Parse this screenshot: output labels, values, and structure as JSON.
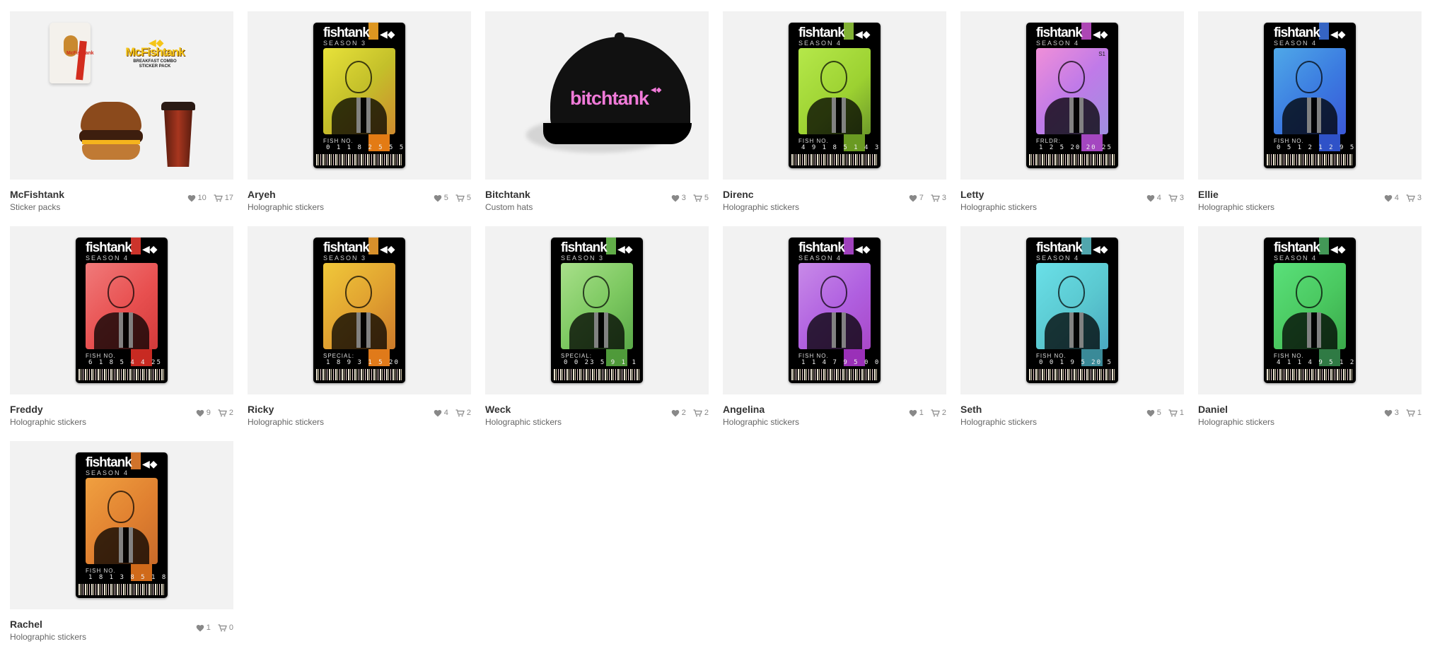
{
  "products": [
    {
      "name": "McFishtank",
      "category": "Sticker packs",
      "likes": "10",
      "carts": "17",
      "kind": "mcfishtank"
    },
    {
      "name": "Aryeh",
      "category": "Holographic stickers",
      "likes": "5",
      "carts": "5",
      "kind": "sticker",
      "season": "SEASON 3",
      "label": "FISH NO.",
      "digits": "0 1 1 8 2 5 5 5",
      "photo": "linear-gradient(135deg,#e8e23a,#c4c02a 50%,#ce8a2e)",
      "band": "#f5a623",
      "block": "#e37b14"
    },
    {
      "name": "Bitchtank",
      "category": "Custom hats",
      "likes": "3",
      "carts": "5",
      "kind": "hat",
      "hat_text": "bitchtank"
    },
    {
      "name": "Direnc",
      "category": "Holographic stickers",
      "likes": "7",
      "carts": "3",
      "kind": "sticker",
      "season": "SEASON 4",
      "label": "FISH NO.",
      "digits": "4 9 1 8 5 1 4 3",
      "photo": "linear-gradient(135deg,#b5e84a,#9cd131 60%,#6e9a2a)",
      "band": "#8fc43a",
      "block": "#6a9a22"
    },
    {
      "name": "Letty",
      "category": "Holographic stickers",
      "likes": "4",
      "carts": "3",
      "kind": "sticker",
      "season": "SEASON 4",
      "label": "FRLDR:",
      "digits": "1 2 5 20 20 25",
      "photo": "linear-gradient(135deg,#f08fd8,#c07ae8 50%,#9f8fe0)",
      "band": "#c04fc8",
      "block": "#a447c0",
      "extra": "S1"
    },
    {
      "name": "Ellie",
      "category": "Holographic stickers",
      "likes": "4",
      "carts": "3",
      "kind": "sticker",
      "season": "SEASON 4",
      "label": "FISH NO.",
      "digits": "0 5 1 2 1 2 9 5",
      "photo": "linear-gradient(135deg,#4fa8e8,#3b7ae0 55%,#3b58d8)",
      "band": "#3b6fd8",
      "block": "#2f52c8"
    },
    {
      "name": "Freddy",
      "category": "Holographic stickers",
      "likes": "9",
      "carts": "2",
      "kind": "sticker",
      "season": "SEASON 4",
      "label": "FISH NO.",
      "digits": "6 1 8 5 4 4 25",
      "photo": "linear-gradient(135deg,#f07a7a,#e85050 55%,#d23a3a)",
      "band": "#e23a30",
      "block": "#c82a22"
    },
    {
      "name": "Ricky",
      "category": "Holographic stickers",
      "likes": "4",
      "carts": "2",
      "kind": "sticker",
      "season": "SEASON 3",
      "label": "SPECIAL:",
      "digits": "1 8 9 3 1 5 20",
      "photo": "linear-gradient(135deg,#f0c83a,#e0a030 55%,#cc7a2a)",
      "band": "#f0a030",
      "block": "#e07a1a"
    },
    {
      "name": "Weck",
      "category": "Holographic stickers",
      "likes": "2",
      "carts": "2",
      "kind": "sticker",
      "season": "SEASON 3",
      "label": "SPECIAL:",
      "digits": "0 0 23 5 9 1 1",
      "photo": "linear-gradient(135deg,#a8e08a,#7cc860 55%,#5aa848)",
      "band": "#6cc050",
      "block": "#4f9a3a"
    },
    {
      "name": "Angelina",
      "category": "Holographic stickers",
      "likes": "1",
      "carts": "2",
      "kind": "sticker",
      "season": "SEASON 4",
      "label": "FISH NO.",
      "digits": "1 1 4 7 9 5 0 0",
      "photo": "linear-gradient(135deg,#c88ae8,#b060e0 55%,#a848c8)",
      "band": "#b048d0",
      "block": "#9a30b8"
    },
    {
      "name": "Seth",
      "category": "Holographic stickers",
      "likes": "5",
      "carts": "1",
      "kind": "sticker",
      "season": "SEASON 4",
      "label": "FISH NO.",
      "digits": "0 0 1 9 5 20 5",
      "photo": "linear-gradient(135deg,#6ae0e8,#5ac8d0 55%,#4aa8c0)",
      "band": "#5ab8c0",
      "block": "#3a8a98"
    },
    {
      "name": "Daniel",
      "category": "Holographic stickers",
      "likes": "3",
      "carts": "1",
      "kind": "sticker",
      "season": "SEASON 4",
      "label": "FISH NO.",
      "digits": "4 1 1 4 9 5 1 2",
      "photo": "linear-gradient(135deg,#5ae07a,#4ac860 55%,#3aa84a)",
      "band": "#4aa860",
      "block": "#2f7a44"
    },
    {
      "name": "Rachel",
      "category": "Holographic stickers",
      "likes": "1",
      "carts": "0",
      "kind": "sticker",
      "season": "SEASON 4",
      "label": "FISH NO.",
      "digits": "1 8 1 3 8 5 1 8",
      "photo": "linear-gradient(135deg,#f0a040,#e08030 55%,#c86a2a)",
      "band": "#e88030",
      "block": "#d06a1a"
    }
  ],
  "mcfishtank": {
    "logo": "McFishtank",
    "subtitle_1": "BREAKFAST COMBO",
    "subtitle_2": "STICKER PACK",
    "bag_label": "McFishtank"
  },
  "sticker_logo": "fishtank",
  "icons": {
    "like": "heart-icon",
    "cart": "cart-icon",
    "fish": "fish-icon"
  }
}
